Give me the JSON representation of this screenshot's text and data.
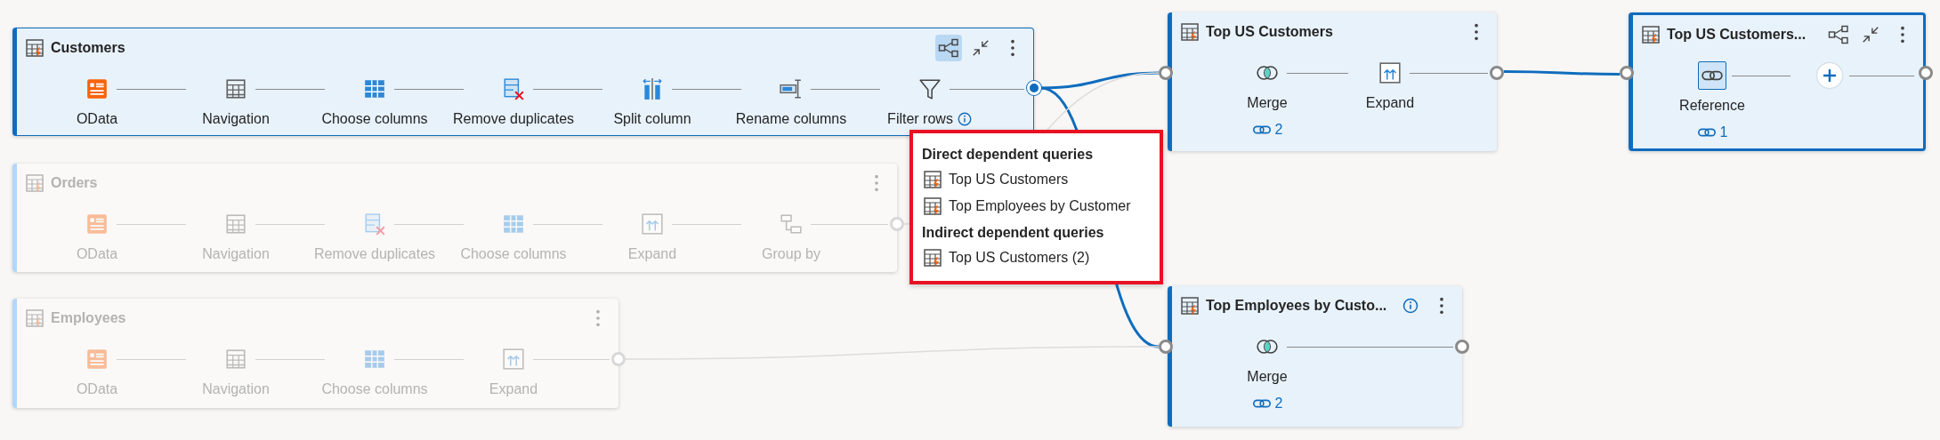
{
  "queries": [
    {
      "title": "Customers",
      "highlighted": true,
      "faded": false,
      "selected": false,
      "output_active": true,
      "actions": [
        {
          "kind": "lineage",
          "selected": true
        },
        {
          "kind": "collapse",
          "selected": false
        },
        {
          "kind": "more",
          "selected": false
        }
      ],
      "steps": [
        {
          "label": "OData",
          "kind": "odata"
        },
        {
          "label": "Navigation",
          "kind": "table"
        },
        {
          "label": "Choose columns",
          "kind": "choose"
        },
        {
          "label": "Remove duplicates",
          "kind": "remove"
        },
        {
          "label": "Split column",
          "kind": "split"
        },
        {
          "label": "Rename columns",
          "kind": "rename"
        },
        {
          "label": "Filter rows",
          "kind": "filter",
          "info": true
        }
      ]
    },
    {
      "title": "Orders",
      "highlighted": false,
      "faded": true,
      "selected": false,
      "output_active": false,
      "actions": [
        {
          "kind": "more",
          "selected": false
        }
      ],
      "steps": [
        {
          "label": "OData",
          "kind": "odata"
        },
        {
          "label": "Navigation",
          "kind": "table"
        },
        {
          "label": "Remove duplicates",
          "kind": "remove"
        },
        {
          "label": "Choose columns",
          "kind": "choose"
        },
        {
          "label": "Expand",
          "kind": "expand"
        },
        {
          "label": "Group by",
          "kind": "groupby"
        }
      ]
    },
    {
      "title": "Employees",
      "highlighted": false,
      "faded": true,
      "selected": false,
      "output_active": false,
      "actions": [
        {
          "kind": "more",
          "selected": false
        }
      ],
      "steps": [
        {
          "label": "OData",
          "kind": "odata"
        },
        {
          "label": "Navigation",
          "kind": "table"
        },
        {
          "label": "Choose columns",
          "kind": "choose"
        },
        {
          "label": "Expand",
          "kind": "expand"
        }
      ]
    },
    {
      "title": "Top US Customers",
      "highlighted": false,
      "faded": false,
      "selected": false,
      "output_active": false,
      "actions": [
        {
          "kind": "more",
          "selected": false
        }
      ],
      "steps": [
        {
          "label": "Merge",
          "kind": "merge",
          "count": "2"
        },
        {
          "label": "Expand",
          "kind": "expand"
        }
      ]
    },
    {
      "title": "Top US Customers...",
      "highlighted": false,
      "faded": false,
      "selected": true,
      "output_active": false,
      "actions": [
        {
          "kind": "lineage",
          "selected": false
        },
        {
          "kind": "collapse",
          "selected": false
        },
        {
          "kind": "more",
          "selected": false
        }
      ],
      "steps": [
        {
          "label": "Reference",
          "kind": "reference",
          "count": "1",
          "selected": true
        },
        {
          "kind": "add",
          "selected": false
        }
      ]
    },
    {
      "title": "Top Employees by Custo...",
      "highlighted": false,
      "faded": false,
      "selected": false,
      "output_active": false,
      "actions": [
        {
          "kind": "info",
          "selected": false
        },
        {
          "kind": "more",
          "selected": false
        }
      ],
      "steps": [
        {
          "label": "Merge",
          "kind": "merge",
          "count": "2"
        }
      ]
    }
  ],
  "links": [
    {
      "highlighted": true
    },
    {
      "highlighted": true
    },
    {
      "highlighted": true
    },
    {
      "highlighted": false
    },
    {
      "highlighted": false
    }
  ],
  "tooltip": {
    "sections": [
      {
        "heading": "Direct dependent queries",
        "items": [
          "Top US Customers",
          "Top Employees by Customer"
        ]
      },
      {
        "heading": "Indirect dependent queries",
        "items": [
          "Top US Customers (2)"
        ]
      }
    ]
  }
}
